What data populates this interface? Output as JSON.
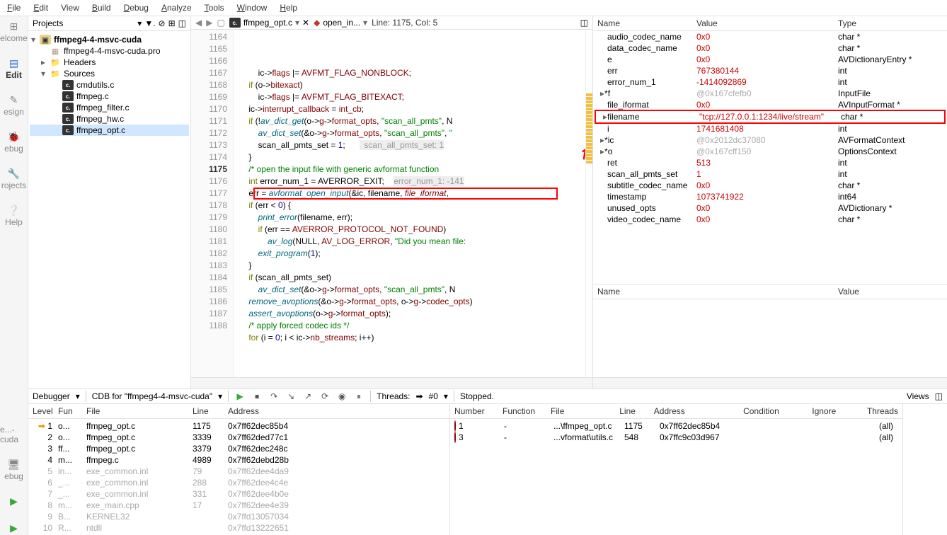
{
  "menu": {
    "file": "File",
    "edit": "Edit",
    "view": "View",
    "build": "Build",
    "debug": "Debug",
    "analyze": "Analyze",
    "tools": "Tools",
    "window": "Window",
    "help": "Help"
  },
  "rail": {
    "welcome": "elcome",
    "edit": "Edit",
    "design": "esign",
    "debug": "ebug",
    "projects": "rojects",
    "help": "Help",
    "cuda": "e...-cuda",
    "debug2": "ebug"
  },
  "projects": {
    "title": "Projects",
    "root": "ffmpeg4-4-msvc-cuda",
    "pro": "ffmpeg4-4-msvc-cuda.pro",
    "headers": "Headers",
    "sources": "Sources",
    "files": [
      "cmdutils.c",
      "ffmpeg.c",
      "ffmpeg_filter.c",
      "ffmpeg_hw.c",
      "ffmpeg_opt.c"
    ]
  },
  "tabs": {
    "main": "ffmpeg_opt.c",
    "second": "open_in...",
    "lineinfo": "Line: 1175, Col: 5"
  },
  "code": {
    "lines": [
      {
        "n": 1164,
        "html": "        ic-><span class='var'>flags</span> |= <span class='var'>AVFMT_FLAG_NONBLOCK</span>;"
      },
      {
        "n": 1165,
        "html": "    <span class='kw'>if</span> (o-><span class='var'>bitexact</span>)"
      },
      {
        "n": 1166,
        "html": "        ic-><span class='var'>flags</span> |= <span class='var'>AVFMT_FLAG_BITEXACT</span>;"
      },
      {
        "n": 1167,
        "html": "    ic-><span class='var'>interrupt_callback</span> = <span class='var'>int_cb</span>;"
      },
      {
        "n": 1168,
        "html": ""
      },
      {
        "n": 1169,
        "html": "    <span class='kw'>if</span> (!<span class='func'>av_dict_get</span>(o-><span class='var'>g</span>-><span class='var'>format_opts</span>, <span class='str'>\"scan_all_pmts\"</span>, N"
      },
      {
        "n": 1170,
        "html": "        <span class='func'>av_dict_set</span>(&o-><span class='var'>g</span>-><span class='var'>format_opts</span>, <span class='str'>\"scan_all_pmts\"</span>, <span class='str'>\""
      },
      {
        "n": 1171,
        "html": "        scan_all_pmts_set = <span class='num'>1</span>;      <span class='dim'>  scan_all_pmts_set: 1</span>"
      },
      {
        "n": 1172,
        "html": "    }"
      },
      {
        "n": 1173,
        "html": "    <span class='com'>/* open the input file with generic avformat function</span>"
      },
      {
        "n": 1174,
        "html": "    <span class='kw'>int</span> error_num_1 = AVERROR_EXIT;    <span class='dim'>error_num_1: -141</span>",
        "warn": true
      },
      {
        "n": 1175,
        "html": "    <span style='background:#fee'>err</span> = <span class='func'>avformat_open_input</span>(&ic, filename, <span class='var' style='font-style:italic'>file_iformat</span>,",
        "cur": true,
        "box": true
      },
      {
        "n": 1176,
        "html": "    <span class='kw'>if</span> (err < <span class='num'>0</span>) {"
      },
      {
        "n": 1177,
        "html": "        <span class='func'>print_error</span>(filename, err);"
      },
      {
        "n": 1178,
        "html": "        <span class='kw'>if</span> (err == <span class='var'>AVERROR_PROTOCOL_NOT_FOUND</span>)"
      },
      {
        "n": 1179,
        "html": "            <span class='func'>av_log</span>(NULL, <span class='var'>AV_LOG_ERROR</span>, <span class='str'>\"Did you mean file:</span>"
      },
      {
        "n": 1180,
        "html": "        <span class='func'>exit_program</span>(<span class='num'>1</span>);"
      },
      {
        "n": 1181,
        "html": "    }"
      },
      {
        "n": 1182,
        "html": "    <span class='kw'>if</span> (scan_all_pmts_set)"
      },
      {
        "n": 1183,
        "html": "        <span class='func'>av_dict_set</span>(&o-><span class='var'>g</span>-><span class='var'>format_opts</span>, <span class='str'>\"scan_all_pmts\"</span>, N"
      },
      {
        "n": 1184,
        "html": "    <span class='func'>remove_avoptions</span>(&o-><span class='var'>g</span>-><span class='var'>format_opts</span>, o-><span class='var'>g</span>-><span class='var'>codec_opts</span>)"
      },
      {
        "n": 1185,
        "html": "    <span class='func'>assert_avoptions</span>(o-><span class='var'>g</span>-><span class='var'>format_opts</span>);"
      },
      {
        "n": 1186,
        "html": ""
      },
      {
        "n": 1187,
        "html": "    <span class='com'>/* apply forced codec ids */</span>"
      },
      {
        "n": 1188,
        "html": "    <span class='kw'>for</span> (i = <span class='num'>0</span>; i < ic-><span class='var'>nb_streams</span>; i++)"
      }
    ]
  },
  "vars": {
    "headers": {
      "name": "Name",
      "value": "Value",
      "type": "Type"
    },
    "rows": [
      {
        "name": "audio_codec_name",
        "value": "0x0",
        "type": "char *"
      },
      {
        "name": "data_codec_name",
        "value": "0x0",
        "type": "char *"
      },
      {
        "name": "e",
        "value": "0x0",
        "type": "AVDictionaryEntry *"
      },
      {
        "name": "err",
        "value": "767380144",
        "type": "int"
      },
      {
        "name": "error_num_1",
        "value": "-1414092869",
        "type": "int"
      },
      {
        "name": "*f",
        "value": "@0x167cfefb0",
        "type": "InputFile",
        "exp": true,
        "dim": true
      },
      {
        "name": "file_iformat",
        "value": "0x0",
        "type": "AVInputFormat *"
      },
      {
        "name": "filename",
        "value": "\"tcp://127.0.0.1:1234/live/stream\"",
        "type": "char *",
        "exp": true,
        "box": true
      },
      {
        "name": "i",
        "value": "1741681408",
        "type": "int"
      },
      {
        "name": "*ic",
        "value": "@0x2012dc37080",
        "type": "AVFormatContext",
        "exp": true,
        "dim": true
      },
      {
        "name": "*o",
        "value": "@0x167cff150",
        "type": "OptionsContext",
        "exp": true,
        "dim": true
      },
      {
        "name": "ret",
        "value": "513",
        "type": "int"
      },
      {
        "name": "scan_all_pmts_set",
        "value": "1",
        "type": "int"
      },
      {
        "name": "subtitle_codec_name",
        "value": "0x0",
        "type": "char *"
      },
      {
        "name": "timestamp",
        "value": "1073741922",
        "type": "int64"
      },
      {
        "name": "unused_opts",
        "value": "0x0",
        "type": "AVDictionary *"
      },
      {
        "name": "video_codec_name",
        "value": "0x0",
        "type": "char *"
      }
    ],
    "watch": {
      "name": "Name",
      "value": "Value"
    }
  },
  "debugger": {
    "label": "Debugger",
    "engine": "CDB for \"ffmpeg4-4-msvc-cuda\"",
    "threads": "Threads:",
    "thread0": "#0",
    "status": "Stopped.",
    "views": "Views"
  },
  "stack": {
    "headers": {
      "level": "Level",
      "fun": "Fun",
      "file": "File",
      "line": "Line",
      "addr": "Address"
    },
    "rows": [
      {
        "level": "1",
        "fun": "o...",
        "file": "ffmpeg_opt.c",
        "line": "1175",
        "addr": "0x7ff62dec85b4",
        "cur": true
      },
      {
        "level": "2",
        "fun": "o...",
        "file": "ffmpeg_opt.c",
        "line": "3339",
        "addr": "0x7ff62ded77c1"
      },
      {
        "level": "3",
        "fun": "ff...",
        "file": "ffmpeg_opt.c",
        "line": "3379",
        "addr": "0x7ff62dec248c"
      },
      {
        "level": "4",
        "fun": "m...",
        "file": "ffmpeg.c",
        "line": "4989",
        "addr": "0x7ff62debd28b"
      },
      {
        "level": "5",
        "fun": "in...",
        "file": "exe_common.inl",
        "line": "79",
        "addr": "0x7ff62dee4da9",
        "dim": true
      },
      {
        "level": "6",
        "fun": "_...",
        "file": "exe_common.inl",
        "line": "288",
        "addr": "0x7ff62dee4c4e",
        "dim": true
      },
      {
        "level": "7",
        "fun": "_...",
        "file": "exe_common.inl",
        "line": "331",
        "addr": "0x7ff62dee4b0e",
        "dim": true
      },
      {
        "level": "8",
        "fun": "m...",
        "file": "exe_main.cpp",
        "line": "17",
        "addr": "0x7ff62dee4e39",
        "dim": true
      },
      {
        "level": "9",
        "fun": "B...",
        "file": "KERNEL32",
        "line": "",
        "addr": "0x7ffd13057034",
        "dim": true
      },
      {
        "level": "10",
        "fun": "R...",
        "file": "ntdll",
        "line": "",
        "addr": "0x7ffd13222651",
        "dim": true
      }
    ]
  },
  "breakpoints": {
    "headers": {
      "num": "Number",
      "fun": "Function",
      "file": "File",
      "line": "Line",
      "addr": "Address",
      "cond": "Condition",
      "ign": "Ignore",
      "thr": "Threads"
    },
    "rows": [
      {
        "num": "1",
        "fun": "-",
        "file": "...\\ffmpeg_opt.c",
        "line": "1175",
        "addr": "0x7ff62dec85b4",
        "thr": "(all)"
      },
      {
        "num": "3",
        "fun": "-",
        "file": "...vformat\\utils.c",
        "line": "548",
        "addr": "0x7ffc9c03d967",
        "thr": "(all)"
      }
    ]
  }
}
